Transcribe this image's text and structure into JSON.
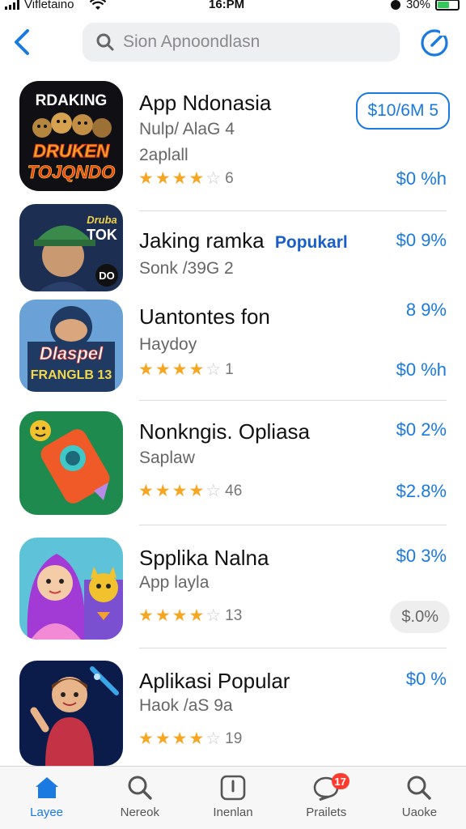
{
  "status_bar": {
    "carrier": "Vifletaino",
    "time": "16:PM",
    "battery": "30%"
  },
  "header": {
    "search_placeholder": "Sion Apnoondlasn"
  },
  "apps": [
    {
      "name": "App Ndonasia",
      "sub1": "Nulp/ AlaG 4",
      "sub2": "2aplall",
      "stars": 4,
      "rating_count": "6",
      "pill": "$10/6M 5",
      "price": "$0 %h",
      "icon_text_1": "RDAKING",
      "icon_text_2": "DRUKEN",
      "icon_text_3": "TOJQNDO",
      "icon_colors": [
        "#0f0f14",
        "#e8411b",
        "#f7b928"
      ]
    },
    {
      "name": "Jaking ramka",
      "tag": "Popukarl",
      "sub1": "Sonk /39G 2",
      "price": "$0 9%",
      "icon_text_1": "Druba",
      "icon_text_2": "TOK",
      "icon_text_3": "DO",
      "icon_colors": [
        "#1c2f52",
        "#3a8a4b",
        "#f0d24a"
      ]
    },
    {
      "name": "Uantontes fon",
      "sub1": "Haydoy",
      "stars": 4,
      "rating_count": "1",
      "price_top": "8 9%",
      "price": "$0 %h",
      "icon_text_1": "Dlaspel",
      "icon_text_2": "FRANGLB 13",
      "icon_colors": [
        "#1f3a63",
        "#d8332a",
        "#6aa2d8"
      ]
    },
    {
      "name": "Nonkngis. Opliasa",
      "sub1": "Saplaw",
      "stars": 4,
      "rating_count": "46",
      "price_top": "$0 2%",
      "price": "$2.8%",
      "icon_colors": [
        "#1e8a4d",
        "#f05a28",
        "#3ec8c8"
      ]
    },
    {
      "name": "Spplika Nalna",
      "sub1": "App layla",
      "stars": 4,
      "rating_count": "13",
      "price_top": "$0 3%",
      "pill": "$.0%",
      "icon_colors": [
        "#a23bd6",
        "#f28ad6",
        "#f2c22e"
      ]
    },
    {
      "name": "Aplikasi Popular",
      "sub1": "Haok /aS 9a",
      "stars": 4,
      "rating_count": "19",
      "price_top": "$0 %",
      "icon_colors": [
        "#0c1c4a",
        "#c43246",
        "#3aa5e8"
      ]
    }
  ],
  "tabs": [
    {
      "label": "Layee",
      "icon": "home-icon",
      "active": true
    },
    {
      "label": "Nereok",
      "icon": "search-icon"
    },
    {
      "label": "Inenlan",
      "icon": "tablet-icon"
    },
    {
      "label": "Prailets",
      "icon": "chat-icon",
      "badge": "17"
    },
    {
      "label": "Uaoke",
      "icon": "search-icon"
    }
  ],
  "colors": {
    "accent": "#1a7ae0",
    "star": "#f5a623",
    "badge": "#ff3b30"
  }
}
